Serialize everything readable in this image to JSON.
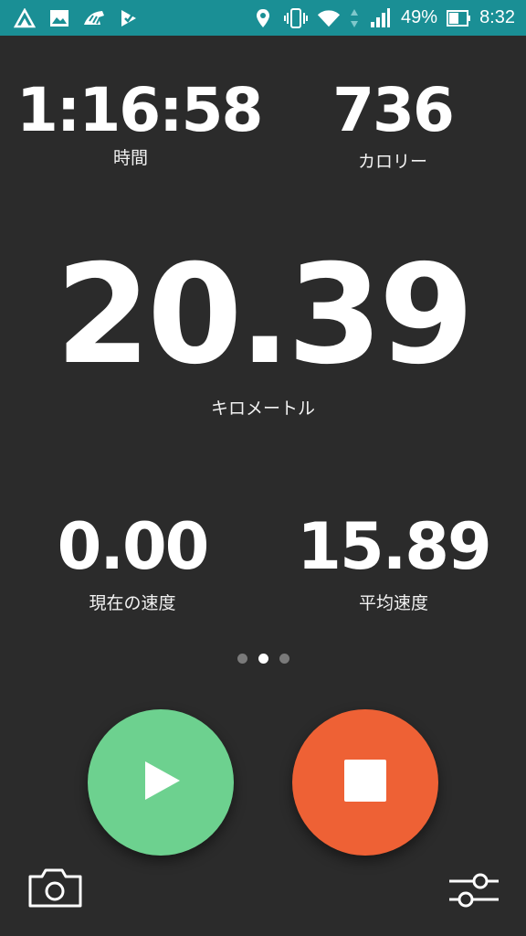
{
  "status_bar": {
    "battery_percent": "49%",
    "time": "8:32",
    "icons": [
      "strava-icon",
      "image-icon",
      "zebra-icon",
      "app-check-icon",
      "location-icon",
      "vibrate-icon",
      "wifi-icon",
      "data-arrows-icon",
      "signal-icon",
      "battery-icon"
    ]
  },
  "stats": {
    "time": {
      "value": "1:16:58",
      "label": "時間"
    },
    "calories": {
      "value": "736",
      "label": "カロリー"
    },
    "distance": {
      "value": "20.39",
      "label": "キロメートル"
    },
    "current_speed": {
      "value": "0.00",
      "label": "現在の速度"
    },
    "avg_speed": {
      "value": "15.89",
      "label": "平均速度"
    }
  },
  "pager": {
    "count": 3,
    "active_index": 1
  },
  "controls": {
    "play_color": "#6dd18f",
    "stop_color": "#ee6135",
    "icons": [
      "play-icon",
      "stop-icon",
      "camera-icon",
      "settings-sliders-icon"
    ]
  },
  "colors": {
    "background": "#2b2b2b",
    "status_bar": "#1a8f95"
  }
}
